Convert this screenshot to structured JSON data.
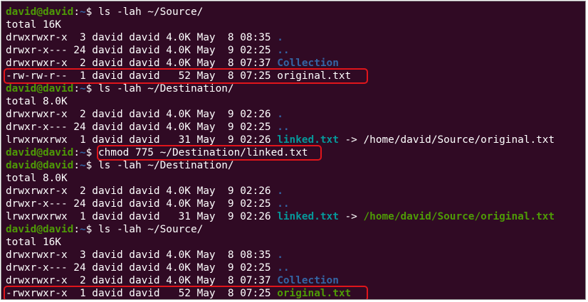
{
  "prompt": {
    "user_host": "david@david",
    "sep": ":",
    "path": "~",
    "symbol": "$ "
  },
  "lines": [
    {
      "type": "prompt",
      "command": "ls -lah ~/Source/"
    },
    {
      "type": "text",
      "text": "total 16K"
    },
    {
      "type": "entry",
      "meta": "drwxrwxr-x  3 david david 4.0K May  8 08:35 ",
      "name": ".",
      "name_style": "dir"
    },
    {
      "type": "entry",
      "meta": "drwxr-x--- 24 david david 4.0K May  9 02:25 ",
      "name": "..",
      "name_style": "dir"
    },
    {
      "type": "entry",
      "meta": "drwxrwxr-x  2 david david 4.0K May  8 07:37 ",
      "name": "Collection",
      "name_style": "dir"
    },
    {
      "type": "entry",
      "meta": "-rw-rw-r--  1 david david   52 May  8 07:25 ",
      "name": "original.txt",
      "name_style": "plain"
    },
    {
      "type": "prompt",
      "command": "ls -lah ~/Destination/"
    },
    {
      "type": "text",
      "text": "total 8.0K"
    },
    {
      "type": "entry",
      "meta": "drwxrwxr-x  2 david david 4.0K May  9 02:26 ",
      "name": ".",
      "name_style": "dir"
    },
    {
      "type": "entry",
      "meta": "drwxr-x--- 24 david david 4.0K May  9 02:25 ",
      "name": "..",
      "name_style": "dir"
    },
    {
      "type": "entry",
      "meta": "lrwxrwxrwx  1 david david   31 May  9 02:26 ",
      "name": "linked.txt",
      "name_style": "link",
      "arrow": " -> ",
      "target": "/home/david/Source/original.txt",
      "target_style": "plain"
    },
    {
      "type": "prompt",
      "command": "chmod 775 ~/Destination/linked.txt"
    },
    {
      "type": "prompt",
      "command": "ls -lah ~/Destination/"
    },
    {
      "type": "text",
      "text": "total 8.0K"
    },
    {
      "type": "entry",
      "meta": "drwxrwxr-x  2 david david 4.0K May  9 02:26 ",
      "name": ".",
      "name_style": "dir"
    },
    {
      "type": "entry",
      "meta": "drwxr-x--- 24 david david 4.0K May  9 02:25 ",
      "name": "..",
      "name_style": "dir"
    },
    {
      "type": "entry",
      "meta": "lrwxrwxrwx  1 david david   31 May  9 02:26 ",
      "name": "linked.txt",
      "name_style": "link",
      "arrow": " -> ",
      "target": "/home/david/Source/original.txt",
      "target_style": "exec"
    },
    {
      "type": "prompt",
      "command": "ls -lah ~/Source/"
    },
    {
      "type": "text",
      "text": "total 16K"
    },
    {
      "type": "entry",
      "meta": "drwxrwxr-x  3 david david 4.0K May  8 08:35 ",
      "name": ".",
      "name_style": "dir"
    },
    {
      "type": "entry",
      "meta": "drwxr-x--- 24 david david 4.0K May  9 02:25 ",
      "name": "..",
      "name_style": "dir"
    },
    {
      "type": "entry",
      "meta": "drwxrwxr-x  2 david david 4.0K May  8 07:37 ",
      "name": "Collection",
      "name_style": "dir"
    },
    {
      "type": "entry",
      "meta": "-rwxrwxr-x  1 david david   52 May  8 07:25 ",
      "name": "original.txt",
      "name_style": "exec"
    }
  ],
  "colors": {
    "background": "#300a24",
    "text": "#ffffff",
    "user_host": "#4e9a06",
    "path": "#3465a4",
    "directory": "#3465a4",
    "symlink": "#06989a",
    "executable": "#4e9a06",
    "highlight_box": "#e0151b"
  }
}
